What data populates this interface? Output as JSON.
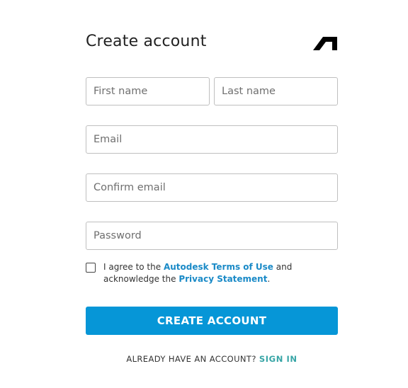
{
  "title": "Create account",
  "logo": {
    "icon": "autodesk-logo-icon",
    "color": "#000000"
  },
  "fields": {
    "first_name": {
      "placeholder": "First name",
      "value": ""
    },
    "last_name": {
      "placeholder": "Last name",
      "value": ""
    },
    "email": {
      "placeholder": "Email",
      "value": ""
    },
    "confirm_email": {
      "placeholder": "Confirm email",
      "value": ""
    },
    "password": {
      "placeholder": "Password",
      "value": ""
    }
  },
  "agreement": {
    "checked": false,
    "text_1": "I agree to the ",
    "terms_link": "Autodesk Terms of Use",
    "text_2": " and acknowledge the ",
    "privacy_link": "Privacy Statement",
    "text_3": "."
  },
  "create_button": {
    "label": "CREATE ACCOUNT",
    "color": "#0696d7"
  },
  "signin": {
    "prompt": "ALREADY HAVE AN ACCOUNT?",
    "link": "SIGN IN",
    "link_color": "#37a5a6"
  },
  "colors": {
    "link": "#1a8ac7",
    "border": "#bfbfbf",
    "text": "#222222"
  }
}
